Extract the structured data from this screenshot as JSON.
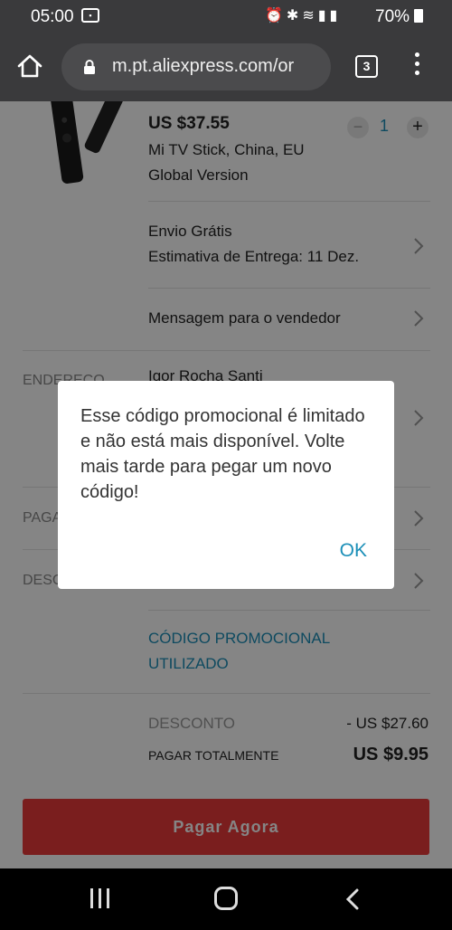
{
  "status_bar": {
    "time": "05:00",
    "battery": "70%"
  },
  "browser": {
    "url": "m.pt.aliexpress.com/or",
    "tab_count": "3"
  },
  "product": {
    "price": "US $37.55",
    "title": "Mi TV Stick,  China,  EU Global Version",
    "quantity": "1",
    "qty_minus": "−",
    "qty_plus": "+"
  },
  "shipping": {
    "line1": "Envio Grátis",
    "line2": "Estimativa de Entrega: 11 Dez."
  },
  "message_seller": "Mensagem para o vendedor",
  "address": {
    "label": "ENDEREÇO",
    "name": "Igor Rocha Santi"
  },
  "payment": {
    "label": "PAGA"
  },
  "discount_section": {
    "label": "DESC"
  },
  "promo_used": "CÓDIGO PROMOCIONAL UTILIZADO",
  "summary": {
    "discount_label": "DESCONTO",
    "discount_value": "- US $27.60",
    "total_label": "PAGAR TOTALMENTE",
    "total_value": "US $9.95"
  },
  "pay_button": "Pagar Agora",
  "dialog": {
    "message": "Esse código promocional é limitado e não está mais disponível. Volte mais tarde para pegar um novo código!",
    "ok": "OK"
  },
  "colors": {
    "accent": "#1b8fb8",
    "pay_button": "#ea3a3a",
    "browser_bar": "#3a3a3c"
  }
}
